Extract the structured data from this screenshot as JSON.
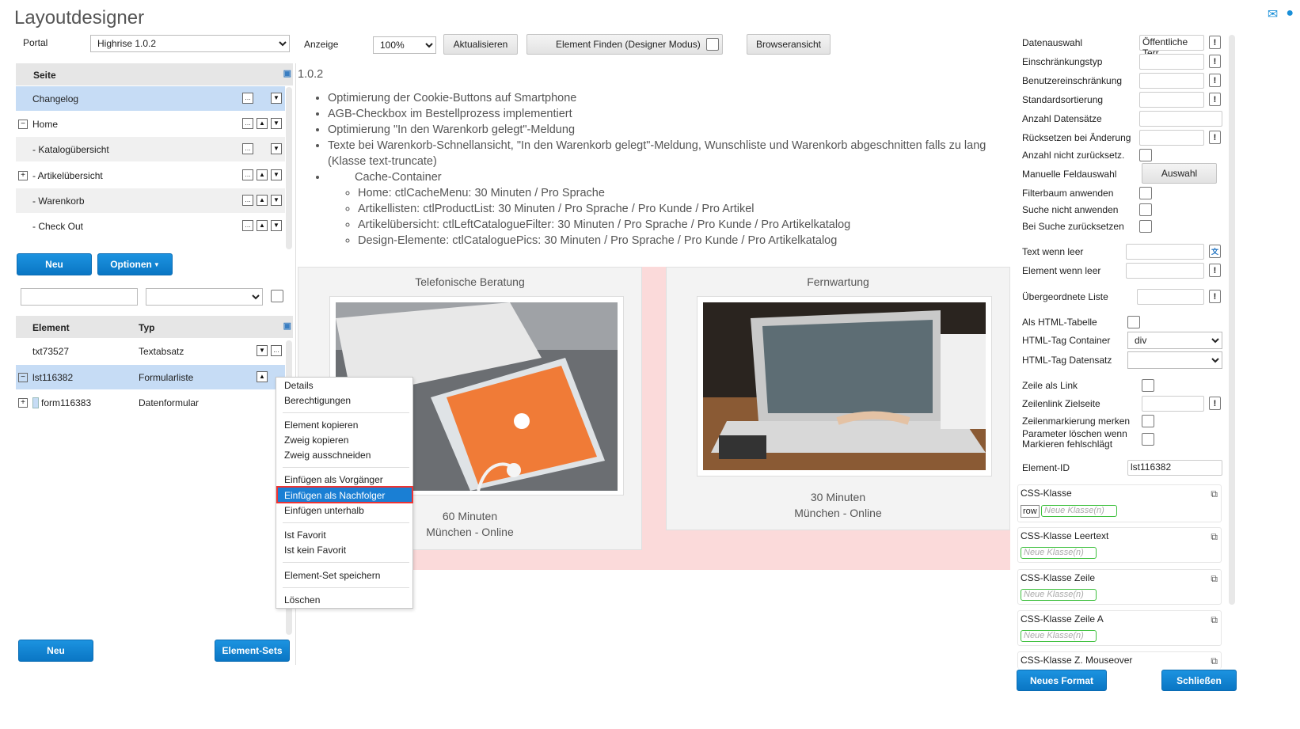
{
  "app": {
    "title": "Layoutdesigner"
  },
  "top": {
    "portal_label": "Portal",
    "portal_value": "Highrise 1.0.2",
    "anzeige_label": "Anzeige",
    "zoom_value": "100%",
    "refresh_button": "Aktualisieren",
    "find_element_button": "Element Finden (Designer Modus)",
    "browser_view_button": "Browseransicht"
  },
  "page_tree": {
    "header": "Seite",
    "items": [
      {
        "label": "Changelog"
      },
      {
        "label": "Home"
      },
      {
        "label": "- Katalogübersicht"
      },
      {
        "label": "- Artikelübersicht"
      },
      {
        "label": "- Warenkorb"
      },
      {
        "label": "- Check Out"
      }
    ],
    "new_button": "Neu",
    "options_button": "Optionen"
  },
  "element_tree": {
    "col_element": "Element",
    "col_type": "Typ",
    "rows": [
      {
        "element": "txt73527",
        "type": "Textabsatz"
      },
      {
        "element": "lst116382",
        "type": "Formularliste"
      },
      {
        "element": "form116383",
        "type": "Datenformular"
      }
    ],
    "new_button": "Neu",
    "sets_button": "Element-Sets"
  },
  "content": {
    "version_text": "1.0.2",
    "bullets": [
      "Optimierung der Cookie-Buttons auf Smartphone",
      "AGB-Checkbox im Bestellprozess implementiert",
      "Optimierung \"In den Warenkorb gelegt\"-Meldung",
      "Texte bei Warenkorb-Schnellansicht, \"In den Warenkorb gelegt\"-Meldung, Wunschliste und Warenkorb abgeschnitten falls zu lang (Klasse text-truncate)"
    ],
    "cache_heading": "Cache-Container",
    "cache_items": [
      "Home: ctlCacheMenu: 30 Minuten / Pro Sprache",
      "Artikellisten: ctlProductList: 30 Minuten / Pro Sprache / Pro Kunde / Pro Artikel",
      "Artikelübersicht: ctlLeftCatalogueFilter: 30 Minuten / Pro Sprache / Pro Kunde / Pro Artikelkatalog",
      "Design-Elemente: ctlCataloguePics: 30 Minuten / Pro Sprache / Pro Kunde / Pro Artikelkatalog"
    ],
    "cards": [
      {
        "title": "Telefonische Beratung",
        "line1": "60 Minuten",
        "line2": "München - Online"
      },
      {
        "title": "Fernwartung",
        "line1": "30 Minuten",
        "line2": "München - Online"
      }
    ]
  },
  "context_menu": {
    "items": [
      "Details",
      "Berechtigungen",
      "Element kopieren",
      "Zweig kopieren",
      "Zweig ausschneiden",
      "Einfügen als Vorgänger",
      "Einfügen als Nachfolger",
      "Einfügen unterhalb",
      "Ist Favorit",
      "Ist kein Favorit",
      "Element-Set speichern",
      "Löschen"
    ],
    "highlighted": "Einfügen als Nachfolger"
  },
  "props": {
    "datenauswahl_label": "Datenauswahl",
    "datenauswahl_value": "Öffentliche Terr",
    "einschraenkungstyp_label": "Einschränkungstyp",
    "benutzereinschraenkung_label": "Benutzereinschränkung",
    "standardsortierung_label": "Standardsortierung",
    "anzahl_label": "Anzahl Datensätze",
    "ruecksetzen_label": "Rücksetzen bei Änderung",
    "anzahl_nicht_label": "Anzahl nicht zurücksetz.",
    "manuelle_label": "Manuelle Feldauswahl",
    "auswahl_button": "Auswahl",
    "filterbaum_label": "Filterbaum anwenden",
    "suche_nicht_label": "Suche nicht anwenden",
    "bei_suche_label": "Bei Suche zurücksetzen",
    "text_leer_label": "Text wenn leer",
    "element_leer_label": "Element wenn leer",
    "uebergeordnete_label": "Übergeordnete Liste",
    "html_tabelle_label": "Als HTML-Tabelle",
    "html_container_label": "HTML-Tag Container",
    "html_container_value": "div",
    "html_datensatz_label": "HTML-Tag Datensatz",
    "zeile_link_label": "Zeile als Link",
    "zeilenlink_label": "Zeilenlink Zielseite",
    "zeilenmarkierung_label": "Zeilenmarkierung merken",
    "parameter_label_1": "Parameter löschen wenn",
    "parameter_label_2": "Markieren fehlschlägt",
    "element_id_label": "Element-ID",
    "element_id_value": "lst116382",
    "css_klasse_label": "CSS-Klasse",
    "css_klasse_tag": "row",
    "css_leertext_label": "CSS-Klasse Leertext",
    "css_zeile_label": "CSS-Klasse Zeile",
    "css_zeile_a_label": "CSS-Klasse Zeile A",
    "css_mouseover_label": "CSS-Klasse Z. Mouseover",
    "new_class_placeholder": "Neue Klasse(n)",
    "neues_format_button": "Neues Format",
    "schliessen_button": "Schließen"
  },
  "colors": {
    "accent": "#0a76c4",
    "selection": "#c6dcf5",
    "highlight_border": "#e33333",
    "card_bg": "#f3f3f3",
    "pink_bg": "#fbdada"
  }
}
